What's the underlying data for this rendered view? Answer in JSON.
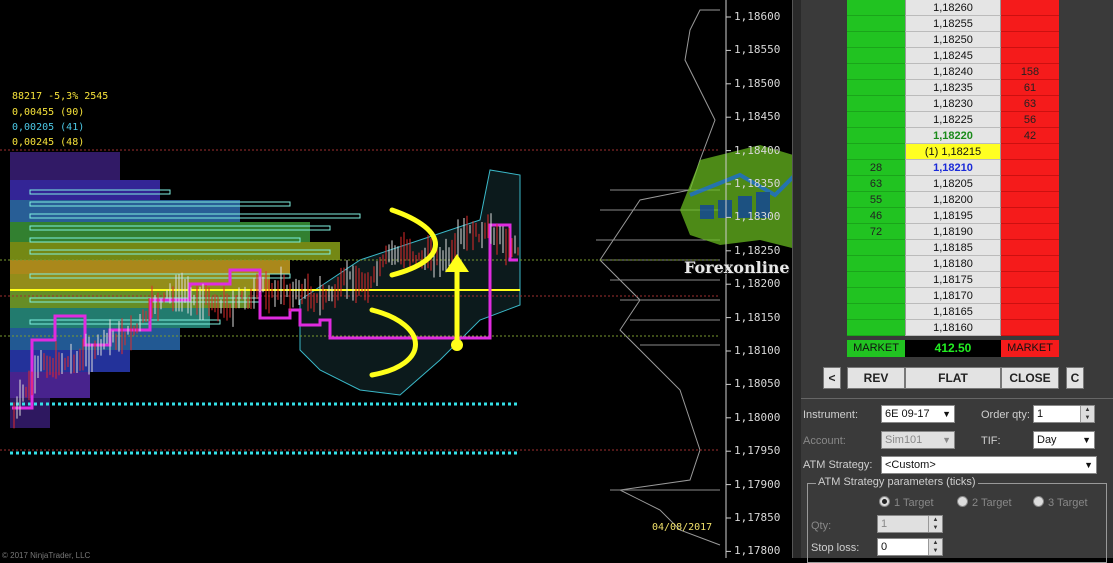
{
  "chart": {
    "info_lines": [
      {
        "text": "88217  -5,3%  2545",
        "color": "#f5e23a"
      },
      {
        "text": "0,00455 (90)",
        "color": "#f5e23a"
      },
      {
        "text": "0,00205 (41)",
        "color": "#4cc8e6"
      },
      {
        "text": "0,00245 (48)",
        "color": "#f5e23a"
      }
    ],
    "price_axis": [
      "1,18600",
      "1,18550",
      "1,18500",
      "1,18450",
      "1,18400",
      "1,18350",
      "1,18300",
      "1,18250",
      "1,18200",
      "1,18150",
      "1,18100",
      "1,18050",
      "1,18000",
      "1,17950",
      "1,17900",
      "1,17850",
      "1,17800"
    ],
    "date_label": "04/08/2017",
    "copyright": "© 2017 NinjaTrader, LLC",
    "watermark_text": "Forexonline",
    "colors": {
      "magenta": "#e02be0",
      "yellow": "#ffff1a",
      "cyan": "#35e0e8",
      "candle_down": "#e02a2a",
      "candle_up": "#e6e6e6"
    }
  },
  "ladder": {
    "rows": [
      {
        "bid": "",
        "price": "1,18260",
        "ask": ""
      },
      {
        "bid": "",
        "price": "1,18255",
        "ask": ""
      },
      {
        "bid": "",
        "price": "1,18250",
        "ask": ""
      },
      {
        "bid": "",
        "price": "1,18245",
        "ask": ""
      },
      {
        "bid": "",
        "price": "1,18240",
        "ask": "158"
      },
      {
        "bid": "",
        "price": "1,18235",
        "ask": "61"
      },
      {
        "bid": "",
        "price": "1,18230",
        "ask": "63"
      },
      {
        "bid": "",
        "price": "1,18225",
        "ask": "56"
      },
      {
        "bid": "",
        "price": "1,18220",
        "ask": "42"
      },
      {
        "bid": "",
        "price": "(1) 1,18215",
        "ask": ""
      },
      {
        "bid": "28",
        "price": "1,18210",
        "ask": ""
      },
      {
        "bid": "63",
        "price": "1,18205",
        "ask": ""
      },
      {
        "bid": "55",
        "price": "1,18200",
        "ask": ""
      },
      {
        "bid": "46",
        "price": "1,18195",
        "ask": ""
      },
      {
        "bid": "72",
        "price": "1,18190",
        "ask": ""
      },
      {
        "bid": "",
        "price": "1,18185",
        "ask": ""
      },
      {
        "bid": "",
        "price": "1,18180",
        "ask": ""
      },
      {
        "bid": "",
        "price": "1,18175",
        "ask": ""
      },
      {
        "bid": "",
        "price": "1,18170",
        "ask": ""
      },
      {
        "bid": "",
        "price": "1,18165",
        "ask": ""
      },
      {
        "bid": "",
        "price": "1,18160",
        "ask": ""
      }
    ],
    "market_left": "MARKET",
    "pnl": "412.50",
    "market_right": "MARKET"
  },
  "buttons": {
    "left": "<",
    "rev": "REV",
    "flat": "FLAT",
    "close": "CLOSE",
    "right": "C"
  },
  "order_form": {
    "instrument_label": "Instrument:",
    "instrument_value": "6E 09-17",
    "order_qty_label": "Order qty:",
    "order_qty_value": "1",
    "account_label": "Account:",
    "account_value": "Sim101",
    "tif_label": "TIF:",
    "tif_value": "Day",
    "atm_label": "ATM Strategy:",
    "atm_value": "<Custom>",
    "params_legend": "ATM Strategy parameters (ticks)",
    "target_options": [
      "1 Target",
      "2 Target",
      "3 Target"
    ],
    "selected_target": "1 Target",
    "qty_label": "Qty:",
    "qty_value": "1",
    "stop_loss_label": "Stop loss:",
    "stop_loss_value": "0"
  }
}
